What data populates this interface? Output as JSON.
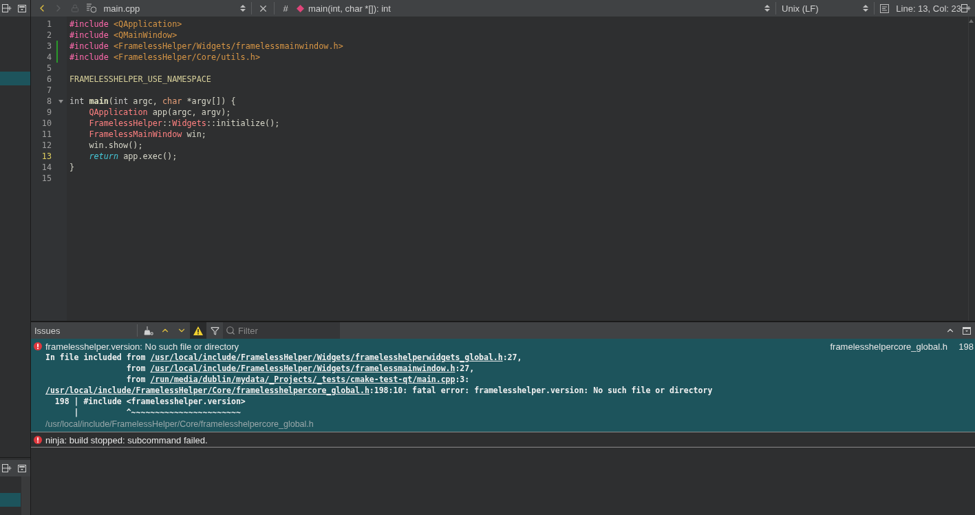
{
  "sidebar": {
    "panes": [
      {
        "rows": [
          {
            "selected": false
          },
          {
            "selected": false
          },
          {
            "selected": false
          },
          {
            "selected": false
          },
          {
            "selected": true
          }
        ]
      },
      {
        "rows": [
          {
            "selected": false
          },
          {
            "selected": true
          }
        ]
      }
    ]
  },
  "toolbar": {
    "back": {
      "disabled": false
    },
    "forward": {
      "disabled": true
    },
    "file": "main.cpp",
    "hash": "#",
    "symbol": "main(int, char *[]): int",
    "line_ending": "Unix (LF)",
    "position": "Line: 13, Col: 23"
  },
  "editor": {
    "lines": [
      {
        "number": "1",
        "current": false,
        "changed": false,
        "foldable": false,
        "tokens": [
          {
            "kind": "preproc",
            "text": "#include "
          },
          {
            "kind": "path",
            "text": "<QApplication>"
          }
        ]
      },
      {
        "number": "2",
        "current": false,
        "changed": false,
        "foldable": false,
        "tokens": [
          {
            "kind": "preproc",
            "text": "#include "
          },
          {
            "kind": "path",
            "text": "<QMainWindow>"
          }
        ]
      },
      {
        "number": "3",
        "current": false,
        "changed": true,
        "foldable": false,
        "tokens": [
          {
            "kind": "preproc",
            "text": "#include "
          },
          {
            "kind": "path",
            "text": "<FramelessHelper/Widgets/framelessmainwindow.h>"
          }
        ]
      },
      {
        "number": "4",
        "current": false,
        "changed": true,
        "foldable": false,
        "tokens": [
          {
            "kind": "preproc",
            "text": "#include "
          },
          {
            "kind": "path",
            "text": "<FramelessHelper/Core/utils.h>"
          }
        ]
      },
      {
        "number": "5",
        "current": false,
        "changed": false,
        "foldable": false
      },
      {
        "number": "6",
        "current": false,
        "changed": false,
        "foldable": false,
        "tokens": [
          {
            "kind": "macro",
            "text": "FRAMELESSHELPER_USE_NAMESPACE"
          }
        ]
      },
      {
        "number": "7",
        "current": false,
        "changed": false,
        "foldable": false
      },
      {
        "number": "8",
        "current": false,
        "changed": false,
        "foldable": true,
        "tokens": [
          {
            "kind": "keyword",
            "text": "int "
          },
          {
            "kind": "function",
            "text": "main"
          },
          {
            "kind": "plain",
            "text": "("
          },
          {
            "kind": "keyword",
            "text": "int"
          },
          {
            "kind": "plain",
            "text": " argc, "
          },
          {
            "kind": "keyword2",
            "text": "char"
          },
          {
            "kind": "plain",
            "text": " *argv[]) {"
          }
        ]
      },
      {
        "number": "9",
        "current": false,
        "changed": false,
        "foldable": false,
        "indented": true,
        "tokens": [
          {
            "kind": "type",
            "text": "QApplication"
          },
          {
            "kind": "plain",
            "text": " app(argc, argv);"
          }
        ]
      },
      {
        "number": "10",
        "current": false,
        "changed": false,
        "foldable": false,
        "indented": true,
        "tokens": [
          {
            "kind": "type",
            "text": "FramelessHelper"
          },
          {
            "kind": "plain",
            "text": "::"
          },
          {
            "kind": "type",
            "text": "Widgets"
          },
          {
            "kind": "plain",
            "text": "::initialize();"
          }
        ]
      },
      {
        "number": "11",
        "current": false,
        "changed": false,
        "foldable": false,
        "indented": true,
        "tokens": [
          {
            "kind": "type",
            "text": "FramelessMainWindow"
          },
          {
            "kind": "plain",
            "text": " win;"
          }
        ]
      },
      {
        "number": "12",
        "current": false,
        "changed": false,
        "foldable": false,
        "indented": true,
        "tokens": [
          {
            "kind": "plain",
            "text": "win.show();"
          }
        ]
      },
      {
        "number": "13",
        "current": true,
        "changed": false,
        "foldable": false,
        "indented": true,
        "tokens": [
          {
            "kind": "flow",
            "text": "return"
          },
          {
            "kind": "plain",
            "text": " app.exec();"
          }
        ]
      },
      {
        "number": "14",
        "current": false,
        "changed": false,
        "foldable": false,
        "tokens": [
          {
            "kind": "plain",
            "text": "}"
          }
        ]
      },
      {
        "number": "15",
        "current": false,
        "changed": false,
        "foldable": false
      }
    ]
  },
  "issues": {
    "title": "Issues",
    "warnings_toggle": {
      "selected": true
    },
    "filter": {
      "placeholder": "Filter"
    },
    "items": [
      {
        "selected": true,
        "message": "framelesshelper.version: No such file or directory",
        "file": "framelesshelpercore_global.h",
        "line": "198",
        "details": [
          [
            {
              "kind": "text",
              "text": "In file included from "
            },
            {
              "kind": "link",
              "text": "/usr/local/include/FramelessHelper/Widgets/framelesshelperwidgets_global.h"
            },
            {
              "kind": "text",
              "text": ":27,"
            }
          ],
          [
            {
              "kind": "text",
              "text": "                 from "
            },
            {
              "kind": "link",
              "text": "/usr/local/include/FramelessHelper/Widgets/framelessmainwindow.h"
            },
            {
              "kind": "text",
              "text": ":27,"
            }
          ],
          [
            {
              "kind": "text",
              "text": "                 from "
            },
            {
              "kind": "link",
              "text": "/run/media/dublin/mydata/_Projects/_tests/cmake-test-qt/main.cpp"
            },
            {
              "kind": "text",
              "text": ":3:"
            }
          ],
          [
            {
              "kind": "link",
              "text": "/usr/local/include/FramelessHelper/Core/framelesshelpercore_global.h"
            },
            {
              "kind": "text",
              "text": ":198:10: fatal error: framelesshelper.version: No such file or directory"
            }
          ],
          [
            {
              "kind": "text",
              "text": "  198 | #include <framelesshelper.version>"
            }
          ],
          [
            {
              "kind": "text",
              "text": "      |          ^~~~~~~~~~~~~~~~~~~~~~~~"
            }
          ]
        ],
        "location": "/usr/local/include/FramelessHelper/Core/framelesshelpercore_global.h"
      },
      {
        "selected": false,
        "message": "ninja: build stopped: subcommand failed."
      }
    ]
  }
}
